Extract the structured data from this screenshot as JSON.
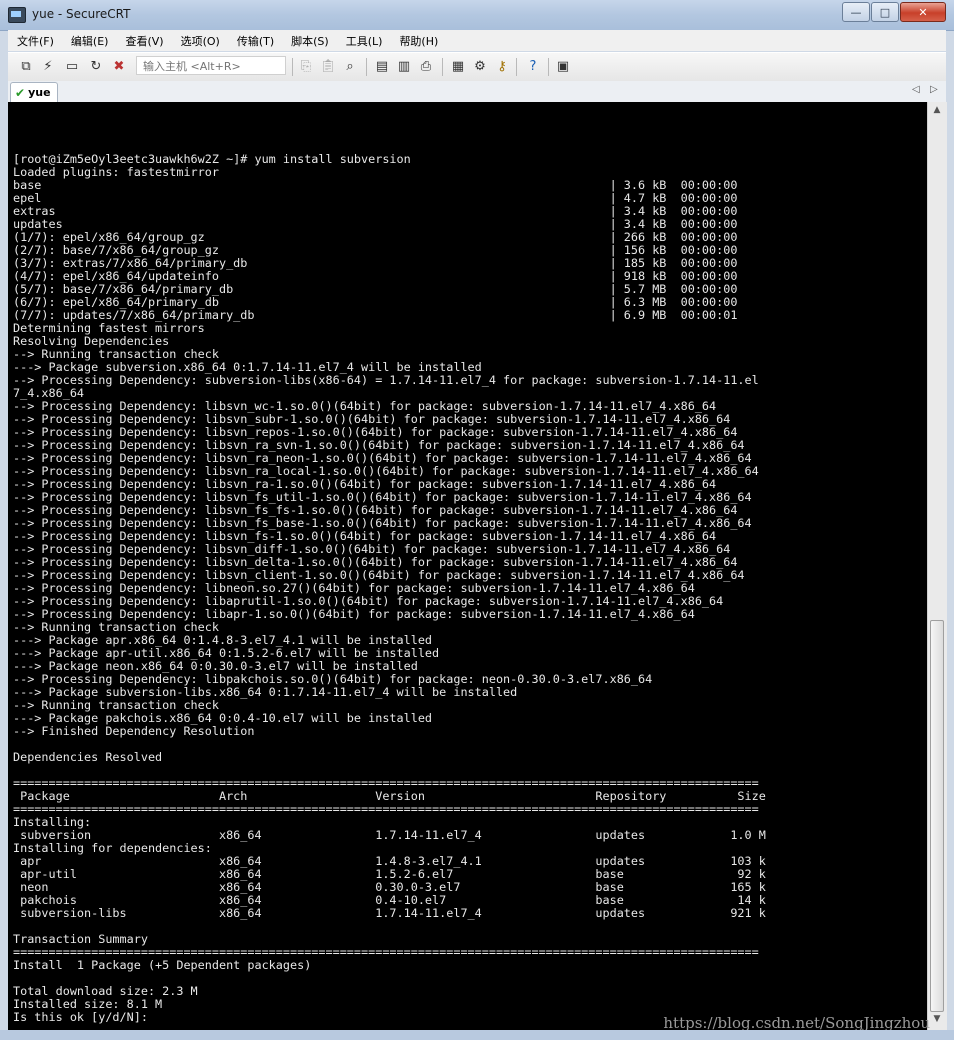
{
  "window": {
    "title": "yue - SecureCRT",
    "min_label": "—",
    "max_label": "□",
    "close_label": "✕"
  },
  "menu": [
    "文件(F)",
    "编辑(E)",
    "查看(V)",
    "选项(O)",
    "传输(T)",
    "脚本(S)",
    "工具(L)",
    "帮助(H)"
  ],
  "toolbar": {
    "host_placeholder": "输入主机 <Alt+R>"
  },
  "tabs": [
    {
      "label": "yue",
      "status": "connected"
    }
  ],
  "watermark": "https://blog.csdn.net/SongJingzhou",
  "terminal": {
    "lines": [
      "[root@iZm5eOyl3eetc3uawkh6w2Z ~]# yum install subversion",
      "Loaded plugins: fastestmirror",
      "base                                                                                | 3.6 kB  00:00:00",
      "epel                                                                                | 4.7 kB  00:00:00",
      "extras                                                                              | 3.4 kB  00:00:00",
      "updates                                                                             | 3.4 kB  00:00:00",
      "(1/7): epel/x86_64/group_gz                                                         | 266 kB  00:00:00",
      "(2/7): base/7/x86_64/group_gz                                                       | 156 kB  00:00:00",
      "(3/7): extras/7/x86_64/primary_db                                                   | 185 kB  00:00:00",
      "(4/7): epel/x86_64/updateinfo                                                       | 918 kB  00:00:00",
      "(5/7): base/7/x86_64/primary_db                                                     | 5.7 MB  00:00:00",
      "(6/7): epel/x86_64/primary_db                                                       | 6.3 MB  00:00:00",
      "(7/7): updates/7/x86_64/primary_db                                                  | 6.9 MB  00:00:01",
      "Determining fastest mirrors",
      "Resolving Dependencies",
      "--> Running transaction check",
      "---> Package subversion.x86_64 0:1.7.14-11.el7_4 will be installed",
      "--> Processing Dependency: subversion-libs(x86-64) = 1.7.14-11.el7_4 for package: subversion-1.7.14-11.el",
      "7_4.x86_64",
      "--> Processing Dependency: libsvn_wc-1.so.0()(64bit) for package: subversion-1.7.14-11.el7_4.x86_64",
      "--> Processing Dependency: libsvn_subr-1.so.0()(64bit) for package: subversion-1.7.14-11.el7_4.x86_64",
      "--> Processing Dependency: libsvn_repos-1.so.0()(64bit) for package: subversion-1.7.14-11.el7_4.x86_64",
      "--> Processing Dependency: libsvn_ra_svn-1.so.0()(64bit) for package: subversion-1.7.14-11.el7_4.x86_64",
      "--> Processing Dependency: libsvn_ra_neon-1.so.0()(64bit) for package: subversion-1.7.14-11.el7_4.x86_64",
      "--> Processing Dependency: libsvn_ra_local-1.so.0()(64bit) for package: subversion-1.7.14-11.el7_4.x86_64",
      "--> Processing Dependency: libsvn_ra-1.so.0()(64bit) for package: subversion-1.7.14-11.el7_4.x86_64",
      "--> Processing Dependency: libsvn_fs_util-1.so.0()(64bit) for package: subversion-1.7.14-11.el7_4.x86_64",
      "--> Processing Dependency: libsvn_fs_fs-1.so.0()(64bit) for package: subversion-1.7.14-11.el7_4.x86_64",
      "--> Processing Dependency: libsvn_fs_base-1.so.0()(64bit) for package: subversion-1.7.14-11.el7_4.x86_64",
      "--> Processing Dependency: libsvn_fs-1.so.0()(64bit) for package: subversion-1.7.14-11.el7_4.x86_64",
      "--> Processing Dependency: libsvn_diff-1.so.0()(64bit) for package: subversion-1.7.14-11.el7_4.x86_64",
      "--> Processing Dependency: libsvn_delta-1.so.0()(64bit) for package: subversion-1.7.14-11.el7_4.x86_64",
      "--> Processing Dependency: libsvn_client-1.so.0()(64bit) for package: subversion-1.7.14-11.el7_4.x86_64",
      "--> Processing Dependency: libneon.so.27()(64bit) for package: subversion-1.7.14-11.el7_4.x86_64",
      "--> Processing Dependency: libaprutil-1.so.0()(64bit) for package: subversion-1.7.14-11.el7_4.x86_64",
      "--> Processing Dependency: libapr-1.so.0()(64bit) for package: subversion-1.7.14-11.el7_4.x86_64",
      "--> Running transaction check",
      "---> Package apr.x86_64 0:1.4.8-3.el7_4.1 will be installed",
      "---> Package apr-util.x86_64 0:1.5.2-6.el7 will be installed",
      "---> Package neon.x86_64 0:0.30.0-3.el7 will be installed",
      "--> Processing Dependency: libpakchois.so.0()(64bit) for package: neon-0.30.0-3.el7.x86_64",
      "---> Package subversion-libs.x86_64 0:1.7.14-11.el7_4 will be installed",
      "--> Running transaction check",
      "---> Package pakchois.x86_64 0:0.4-10.el7 will be installed",
      "--> Finished Dependency Resolution",
      "",
      "Dependencies Resolved",
      "",
      "=========================================================================================================",
      " Package                     Arch                  Version                        Repository          Size",
      "=========================================================================================================",
      "Installing:",
      " subversion                  x86_64                1.7.14-11.el7_4                updates            1.0 M",
      "Installing for dependencies:",
      " apr                         x86_64                1.4.8-3.el7_4.1                updates            103 k",
      " apr-util                    x86_64                1.5.2-6.el7                    base                92 k",
      " neon                        x86_64                0.30.0-3.el7                   base               165 k",
      " pakchois                    x86_64                0.4-10.el7                     base                14 k",
      " subversion-libs             x86_64                1.7.14-11.el7_4                updates            921 k",
      "",
      "Transaction Summary",
      "=========================================================================================================",
      "Install  1 Package (+5 Dependent packages)",
      "",
      "Total download size: 2.3 M",
      "Installed size: 8.1 M",
      "Is this ok [y/d/N]: "
    ]
  }
}
